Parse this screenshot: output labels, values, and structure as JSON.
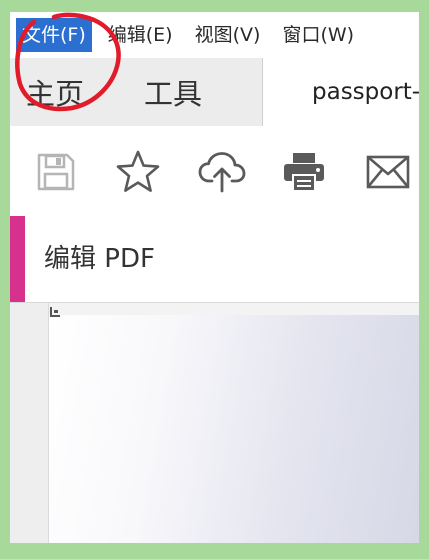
{
  "menubar": {
    "items": [
      "文件(F)",
      "编辑(E)",
      "视图(V)",
      "窗口(W)"
    ]
  },
  "tabs": {
    "home": "主页",
    "tools": "工具",
    "document": "passport-"
  },
  "toolbar": {
    "icons": [
      "save-icon",
      "star-icon",
      "cloud-upload-icon",
      "printer-icon",
      "mail-icon"
    ]
  },
  "panel": {
    "title": "编辑 PDF"
  },
  "colors": {
    "menu_active": "#2b6fd1",
    "accent": "#d6318d",
    "annotation": "#e11b2a",
    "frame": "#a6d99a"
  }
}
